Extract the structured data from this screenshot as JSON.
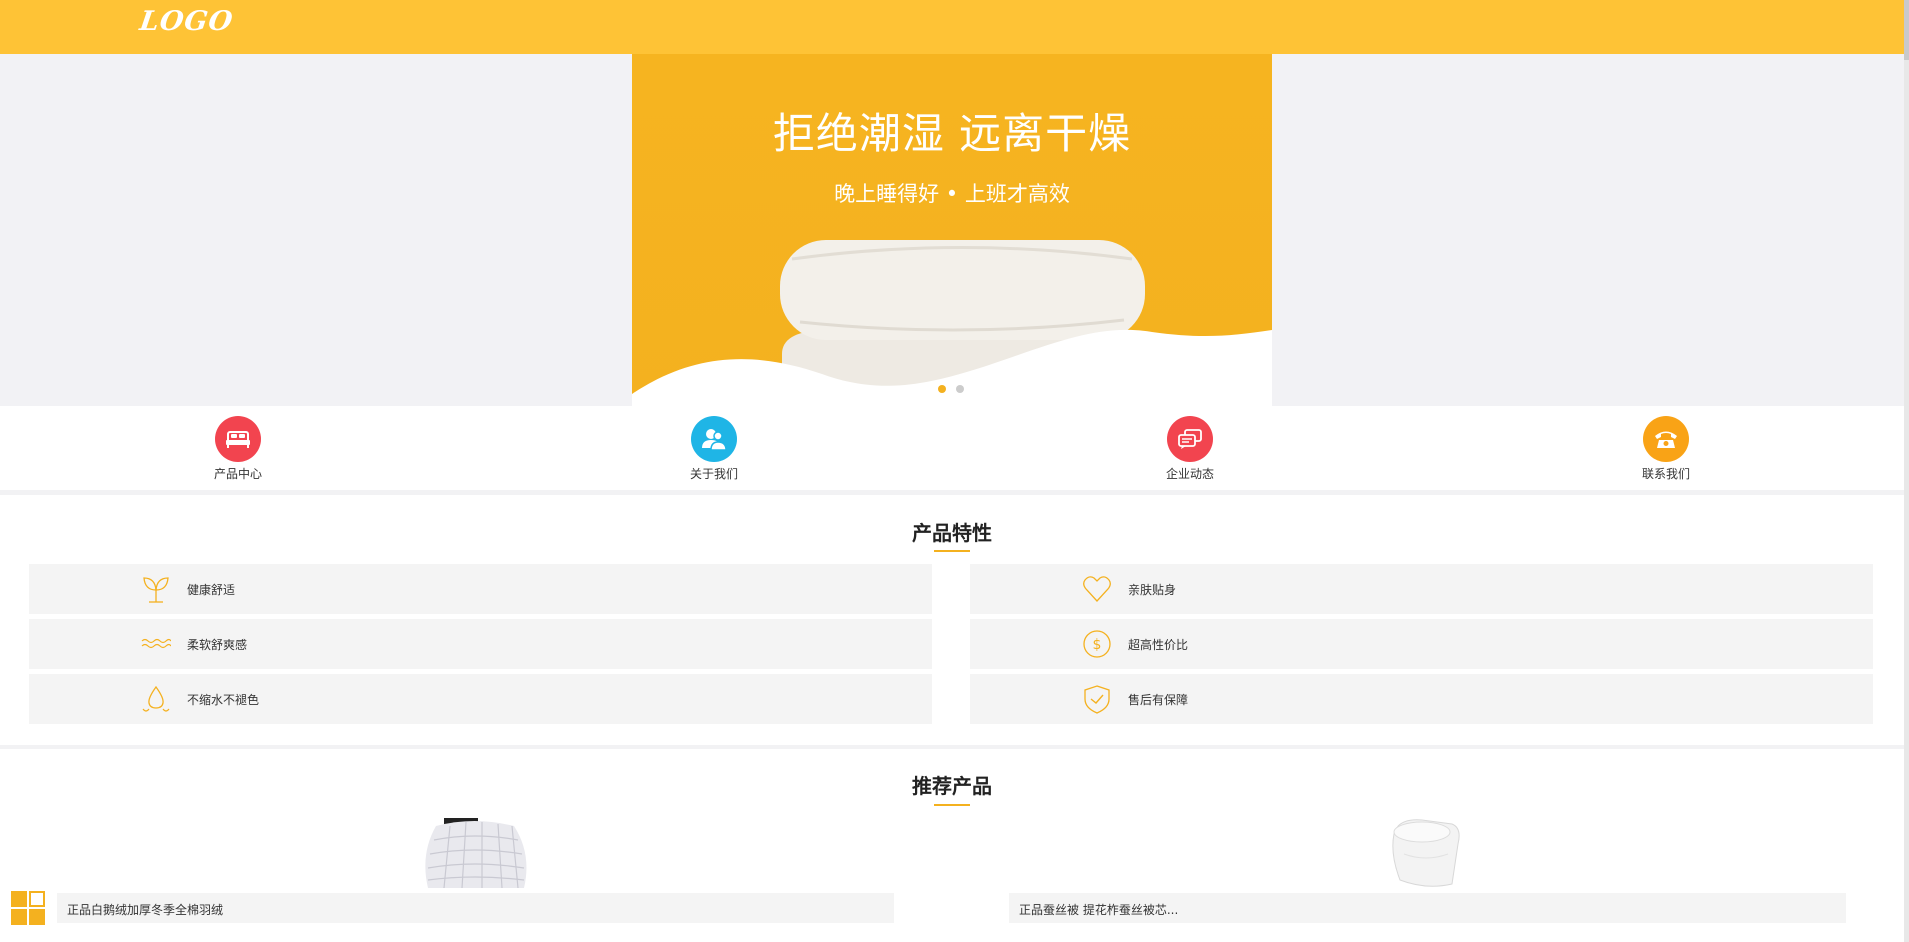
{
  "header": {
    "logo_text": "LOGO"
  },
  "banner": {
    "title": "拒绝潮湿 远离干燥",
    "subtitle": "晚上睡得好 • 上班才高效",
    "active_slide": 1,
    "slide_count": 2
  },
  "nav": {
    "items": [
      {
        "label": "产品中心",
        "icon": "bed-icon",
        "color": "#f2444f"
      },
      {
        "label": "关于我们",
        "icon": "people-icon",
        "color": "#1fb5e6"
      },
      {
        "label": "企业动态",
        "icon": "chat-bubbles-icon",
        "color": "#f2444f"
      },
      {
        "label": "联系我们",
        "icon": "phone-icon",
        "color": "#f9a316"
      }
    ]
  },
  "features": {
    "title": "产品特性",
    "items": [
      {
        "label": "健康舒适",
        "icon": "sprout-icon"
      },
      {
        "label": "亲肤贴身",
        "icon": "heart-icon"
      },
      {
        "label": "柔软舒爽感",
        "icon": "waves-icon"
      },
      {
        "label": "超高性价比",
        "icon": "dollar-icon"
      },
      {
        "label": "不缩水不褪色",
        "icon": "water-drop-icon"
      },
      {
        "label": "售后有保障",
        "icon": "shield-check-icon"
      }
    ]
  },
  "products": {
    "title": "推荐产品",
    "items": [
      {
        "name": "正品白鹅绒加厚冬季全棉羽绒"
      },
      {
        "name": "正品蚕丝被 提花柞蚕丝被芯..."
      }
    ]
  },
  "colors": {
    "brand": "#fec336",
    "accent": "#f4b11f"
  }
}
